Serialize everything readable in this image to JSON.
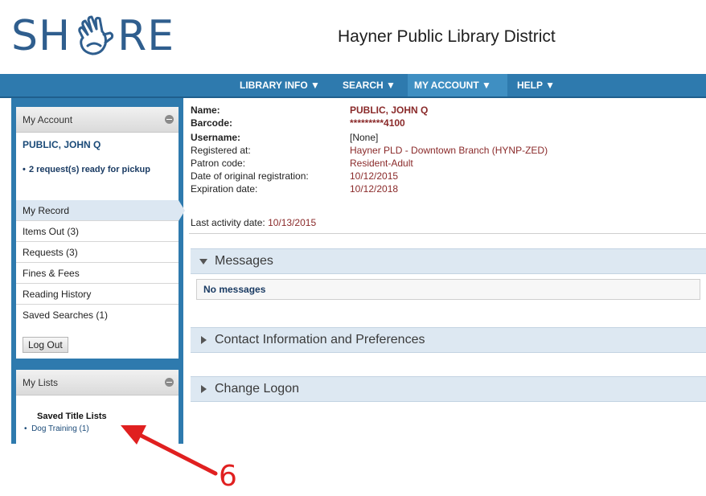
{
  "header": {
    "logo_left": "SH",
    "logo_right": "RE",
    "library_name": "Hayner Public Library District"
  },
  "nav": {
    "items": [
      {
        "label": "LIBRARY INFO ▼"
      },
      {
        "label": "SEARCH ▼"
      },
      {
        "label": "MY ACCOUNT ▼"
      },
      {
        "label": "HELP ▼"
      }
    ]
  },
  "sidebar": {
    "account_title": "My Account",
    "patron_name": "PUBLIC, JOHN Q",
    "notice": "2 request(s) ready for pickup",
    "menu": [
      {
        "label": "My Record"
      },
      {
        "label": "Items Out (3)"
      },
      {
        "label": "Requests (3)"
      },
      {
        "label": "Fines & Fees"
      },
      {
        "label": "Reading History"
      },
      {
        "label": "Saved Searches (1)"
      }
    ],
    "logout_label": "Log Out",
    "lists_title": "My Lists",
    "saved_title_lists": "Saved Title Lists",
    "list_entry": "Dog Training (1)"
  },
  "record": {
    "name_label": "Name:",
    "name_value": "PUBLIC, JOHN Q",
    "barcode_label": "Barcode:",
    "barcode_value": "*********4100",
    "username_label": "Username:",
    "username_value": "[None]",
    "registered_label": "Registered at:",
    "registered_value": "Hayner PLD - Downtown Branch (HYNP-ZED)",
    "patron_code_label": "Patron code:",
    "patron_code_value": "Resident-Adult",
    "original_reg_label": "Date of original registration:",
    "original_reg_value": "10/12/2015",
    "expiration_label": "Expiration date:",
    "expiration_value": "10/12/2018",
    "last_activity_label": "Last activity date:",
    "last_activity_value": "10/13/2015"
  },
  "sections": {
    "messages": "Messages",
    "no_messages": "No messages",
    "contact": "Contact Information and Preferences",
    "change_logon": "Change Logon"
  },
  "annotation": {
    "number": "6"
  },
  "colors": {
    "nav_blue": "#2e7aae",
    "value_red": "#8a2a2a",
    "annotation_red": "#e02020"
  }
}
